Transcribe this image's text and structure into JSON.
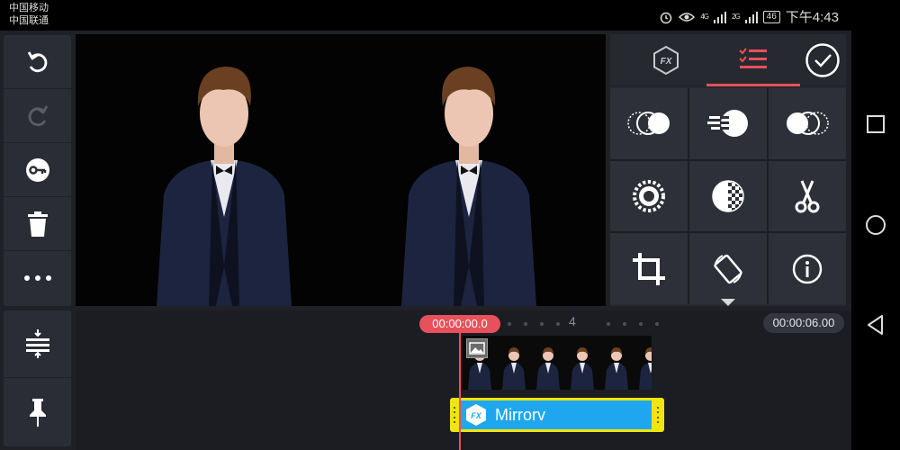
{
  "status_bar": {
    "carrier_1": "中国移动",
    "carrier_2": "中国联通",
    "signal_1": "4G",
    "signal_2": "2G",
    "battery": "46",
    "time": "下午4:43"
  },
  "left_toolbar": {
    "items": [
      {
        "icon": "undo-icon"
      },
      {
        "icon": "redo-icon"
      },
      {
        "icon": "key-icon"
      },
      {
        "icon": "trash-icon"
      },
      {
        "icon": "more-icon"
      }
    ]
  },
  "effect_panel": {
    "tabs": [
      {
        "icon": "fx-icon",
        "active": false
      },
      {
        "icon": "checklist-icon",
        "active": true
      }
    ],
    "confirm_icon": "check-circle-icon",
    "grid_icons": [
      "blend-left-icon",
      "speed-icon",
      "blend-right-icon",
      "gear-icon",
      "checker-circle-icon",
      "scissors-icon",
      "crop-icon",
      "rotate-icon",
      "info-icon"
    ]
  },
  "timeline": {
    "playhead_time": "00:00:00.0",
    "tick_label": "4",
    "duration": "00:00:06.00",
    "effect_clip_label": "Mirrorv",
    "thumb_count": 6
  },
  "bottom_toolbar": {
    "items": [
      {
        "icon": "track-align-icon"
      },
      {
        "icon": "pin-icon"
      }
    ]
  },
  "colors": {
    "accent": "#e8505b",
    "effect_clip_bg": "#1ea7ee",
    "effect_clip_border": "#f2e40f",
    "panel_bg": "#262930",
    "app_bg": "#1f2127"
  }
}
